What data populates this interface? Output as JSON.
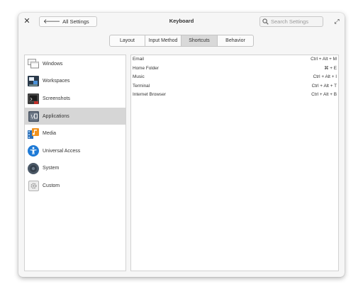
{
  "window": {
    "title": "Keyboard",
    "back_label": "All Settings",
    "search_placeholder": "Search Settings"
  },
  "tabs": [
    {
      "label": "Layout",
      "active": false
    },
    {
      "label": "Input Method",
      "active": false
    },
    {
      "label": "Shortcuts",
      "active": true
    },
    {
      "label": "Behavior",
      "active": false
    }
  ],
  "sidebar": {
    "selected": "Applications",
    "items": [
      {
        "label": "Windows",
        "icon": "windows-icon"
      },
      {
        "label": "Workspaces",
        "icon": "workspaces-icon"
      },
      {
        "label": "Screenshots",
        "icon": "screenshots-icon"
      },
      {
        "label": "Applications",
        "icon": "applications-icon"
      },
      {
        "label": "Media",
        "icon": "media-icon"
      },
      {
        "label": "Universal Access",
        "icon": "universal-access-icon"
      },
      {
        "label": "System",
        "icon": "system-icon"
      },
      {
        "label": "Custom",
        "icon": "custom-icon"
      }
    ]
  },
  "shortcuts": [
    {
      "name": "Email",
      "keys": "Ctrl + Alt + M"
    },
    {
      "name": "Home Folder",
      "keys": "⌘ + E"
    },
    {
      "name": "Music",
      "keys": "Ctrl + Alt + I"
    },
    {
      "name": "Terminal",
      "keys": "Ctrl + Alt + T"
    },
    {
      "name": "Internet Browser",
      "keys": "Ctrl + Alt + B"
    }
  ],
  "colors": {
    "selected_bg": "#d6d6d6",
    "active_tab_bg": "#d9d9d9",
    "accessibility_blue": "#1e7ad6"
  }
}
